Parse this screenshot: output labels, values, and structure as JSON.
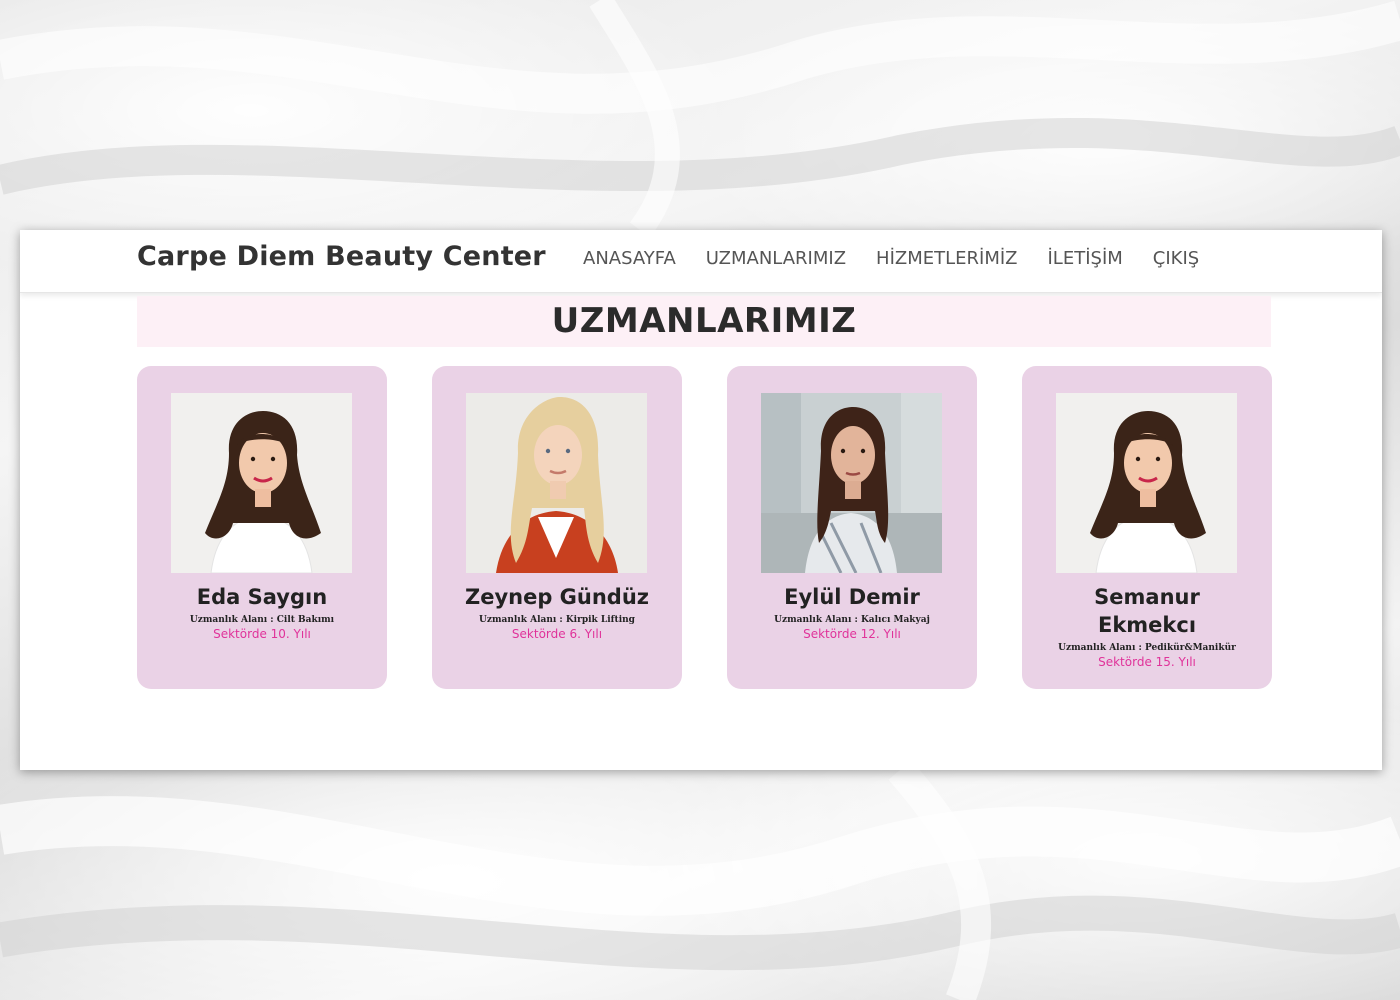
{
  "site": {
    "brand": "Carpe Diem Beauty Center",
    "nav": [
      "ANASAYFA",
      "UZMANLARIMIZ",
      "HİZMETLERİMİZ",
      "İLETİŞİM",
      "ÇIKIŞ"
    ]
  },
  "section": {
    "title": "UZMANLARIMIZ"
  },
  "experts": [
    {
      "name": "Eda Saygın",
      "specialty": "Uzmanlık Alanı : Cilt Bakımı",
      "years": "Sektörde 10. Yılı",
      "photo_icon": "portrait-curly-dark-hair"
    },
    {
      "name": "Zeynep Gündüz",
      "specialty": "Uzmanlık Alanı : Kirpik Lifting",
      "years": "Sektörde 6. Yılı",
      "photo_icon": "portrait-blonde-red-jacket"
    },
    {
      "name": "Eylül Demir",
      "specialty": "Uzmanlık Alanı : Kalıcı Makyaj",
      "years": "Sektörde 12. Yılı",
      "photo_icon": "portrait-office-background"
    },
    {
      "name": "Semanur Ekmekcı",
      "specialty": "Uzmanlık Alanı : Pedikür&Manikür",
      "years": "Sektörde 15. Yılı",
      "photo_icon": "portrait-curly-dark-hair"
    }
  ],
  "colors": {
    "card_bg": "#ead2e6",
    "banner_bg": "#fdf0f6",
    "years_text": "#e0339a"
  }
}
